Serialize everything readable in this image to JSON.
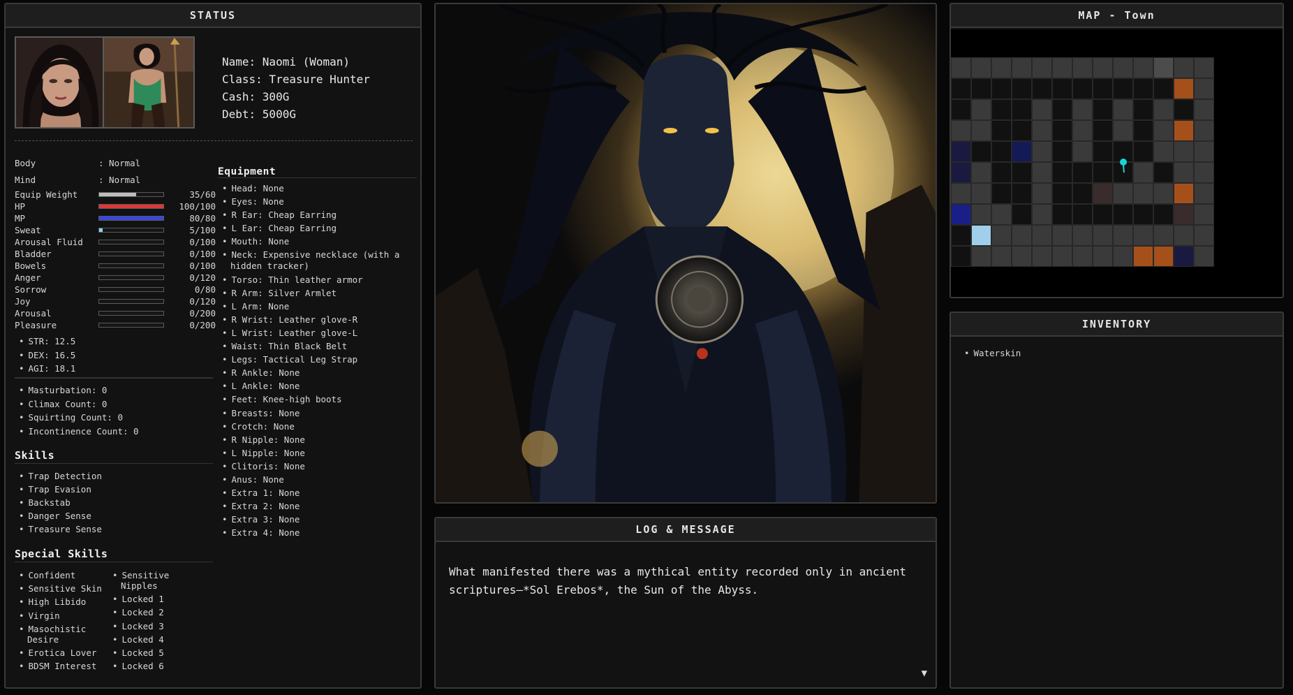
{
  "status": {
    "title": "STATUS",
    "name": "Name: Naomi (Woman)",
    "class": "Class: Treasure Hunter",
    "cash": "Cash: 300G",
    "debt": "Debt: 5000G",
    "conditions": [
      {
        "label": "Body",
        "value": ": Normal"
      },
      {
        "label": "Mind",
        "value": ": Normal"
      }
    ],
    "bars": [
      {
        "label": "Equip Weight",
        "value": "35/60",
        "fraction": 0.58,
        "color": "#bdbdbd"
      },
      {
        "label": "HP",
        "value": "100/100",
        "fraction": 1.0,
        "color": "#e03636"
      },
      {
        "label": "MP",
        "value": "80/80",
        "fraction": 1.0,
        "color": "#3a46e0"
      },
      {
        "label": "Sweat",
        "value": "5/100",
        "fraction": 0.05,
        "color": "#8fd0f2"
      },
      {
        "label": "Arousal Fluid",
        "value": "0/100",
        "fraction": 0,
        "color": "#cccccc"
      },
      {
        "label": "Bladder",
        "value": "0/100",
        "fraction": 0,
        "color": "#cccccc"
      },
      {
        "label": "Bowels",
        "value": "0/100",
        "fraction": 0,
        "color": "#cccccc"
      },
      {
        "label": "Anger",
        "value": "0/120",
        "fraction": 0,
        "color": "#cccccc"
      },
      {
        "label": "Sorrow",
        "value": "0/80",
        "fraction": 0,
        "color": "#cccccc"
      },
      {
        "label": "Joy",
        "value": "0/120",
        "fraction": 0,
        "color": "#cccccc"
      },
      {
        "label": "Arousal",
        "value": "0/200",
        "fraction": 0,
        "color": "#cccccc"
      },
      {
        "label": "Pleasure",
        "value": "0/200",
        "fraction": 0,
        "color": "#cccccc"
      }
    ],
    "attributes": [
      "STR: 12.5",
      "DEX: 16.5",
      "AGI: 18.1"
    ],
    "counts": [
      "Masturbation: 0",
      "Climax Count: 0",
      "Squirting Count: 0",
      "Incontinence Count: 0"
    ],
    "skills_title": "Skills",
    "skills": [
      "Trap Detection",
      "Trap Evasion",
      "Backstab",
      "Danger Sense",
      "Treasure Sense"
    ],
    "special_title": "Special Skills",
    "special_left": [
      "Confident",
      "Sensitive Skin",
      "High Libido",
      "Virgin",
      "Masochistic Desire",
      "Erotica Lover",
      "BDSM Interest"
    ],
    "special_right": [
      "Sensitive Nipples",
      "Locked 1",
      "Locked 2",
      "Locked 3",
      "Locked 4",
      "Locked 5",
      "Locked 6"
    ],
    "equipment_title": "Equipment",
    "equipment": [
      "Head: None",
      "Eyes: None",
      "R Ear: Cheap Earring",
      "L Ear: Cheap Earring",
      "Mouth: None",
      "Neck: Expensive necklace (with a hidden tracker)",
      "Torso: Thin leather armor",
      "R Arm: Silver Armlet",
      "L Arm: None",
      "R Wrist: Leather glove-R",
      "L Wrist: Leather glove-L",
      "Waist: Thin Black Belt",
      "Legs: Tactical Leg Strap",
      "R Ankle: None",
      "L Ankle: None",
      "Feet: Knee-high boots",
      "Breasts: None",
      "Crotch: None",
      "R Nipple: None",
      "L Nipple: None",
      "Clitoris: None",
      "Anus: None",
      "Extra 1: None",
      "Extra 2: None",
      "Extra 3: None",
      "Extra 4: None"
    ]
  },
  "log": {
    "title": "LOG & MESSAGE",
    "message": "What manifested there was a mythical entity recorded only in ancient scriptures—*Sol Erebos*, the Sun of the Abyss.",
    "continue_icon": "▼"
  },
  "map": {
    "title": "MAP - Town",
    "colors": {
      "floor": "#3a3a3a",
      "dark": "#111111",
      "wall": "#141414",
      "light": "#4c4c4c",
      "orange": "#a5501a",
      "navy": "#141a55",
      "blue": "#1a1f88",
      "ice": "#9fcfea",
      "brown": "#3a2c2c",
      "pin": "#19d3d3"
    },
    "grid": [
      "LLLLLLLLLLXLL",
      "DDDDDDDDDDDOL",
      "DLDDLDLDLDLDL",
      "LLDDLDLDLDLOL",
      "BDDNLDLDDDLLL",
      "BLDDLDDDDLDLL",
      "LLDDLDDRLLLOL",
      "ULLDLDDDDDDRL",
      "DILLLLLLLLLLL",
      "DLLLLLLLLOOBL"
    ],
    "player": {
      "row": 5,
      "col": 8
    }
  },
  "inventory": {
    "title": "INVENTORY",
    "items": [
      "Waterskin"
    ]
  }
}
